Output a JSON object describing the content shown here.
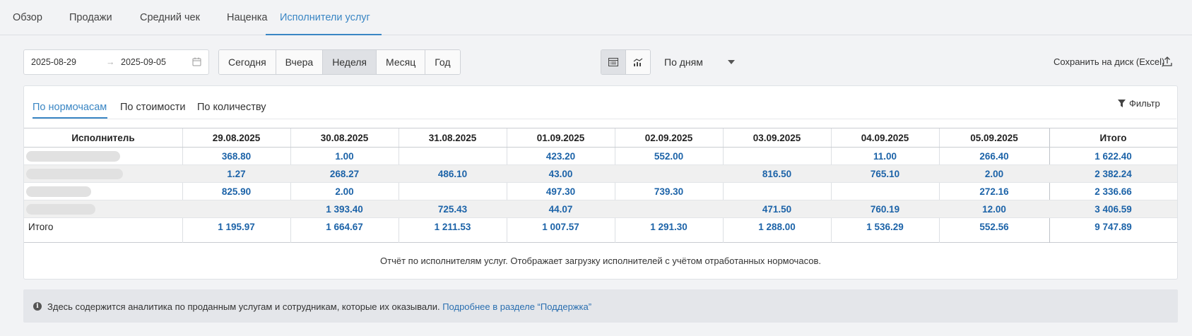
{
  "tabs": [
    "Обзор",
    "Продажи",
    "Средний чек",
    "Наценка",
    "Исполнители услуг"
  ],
  "date_from": "2025-08-29",
  "date_to": "2025-09-05",
  "periods": [
    "Сегодня",
    "Вчера",
    "Неделя",
    "Месяц",
    "Год"
  ],
  "grouping": "По дням",
  "save_label": "Сохранить на диск (Excel)",
  "sub_tabs": [
    "По нормочасам",
    "По стоимости",
    "По количеству"
  ],
  "filter_label": "Фильтр",
  "table": {
    "headers": [
      "Исполнитель",
      "29.08.2025",
      "30.08.2025",
      "31.08.2025",
      "01.09.2025",
      "02.09.2025",
      "03.09.2025",
      "04.09.2025",
      "05.09.2025",
      "Итого"
    ],
    "rows": [
      [
        "368.80",
        "1.00",
        "",
        "423.20",
        "552.00",
        "",
        "11.00",
        "266.40",
        "1 622.40"
      ],
      [
        "1.27",
        "268.27",
        "486.10",
        "43.00",
        "",
        "816.50",
        "765.10",
        "2.00",
        "2 382.24"
      ],
      [
        "825.90",
        "2.00",
        "",
        "497.30",
        "739.30",
        "",
        "",
        "272.16",
        "2 336.66"
      ],
      [
        "",
        "1 393.40",
        "725.43",
        "44.07",
        "",
        "471.50",
        "760.19",
        "12.00",
        "3 406.59"
      ]
    ],
    "total_label": "Итого",
    "totals": [
      "1 195.97",
      "1 664.67",
      "1 211.53",
      "1 007.57",
      "1 291.30",
      "1 288.00",
      "1 536.29",
      "552.56",
      "9 747.89"
    ]
  },
  "description": "Отчёт по исполнителям услуг. Отображает загрузку исполнителей с учётом отработанных нормочасов.",
  "info_text": "Здесь содержится аналитика по проданным услугам и сотрудникам, которые их оказывали.",
  "info_link": "Подробнее в разделе “Поддержка”"
}
